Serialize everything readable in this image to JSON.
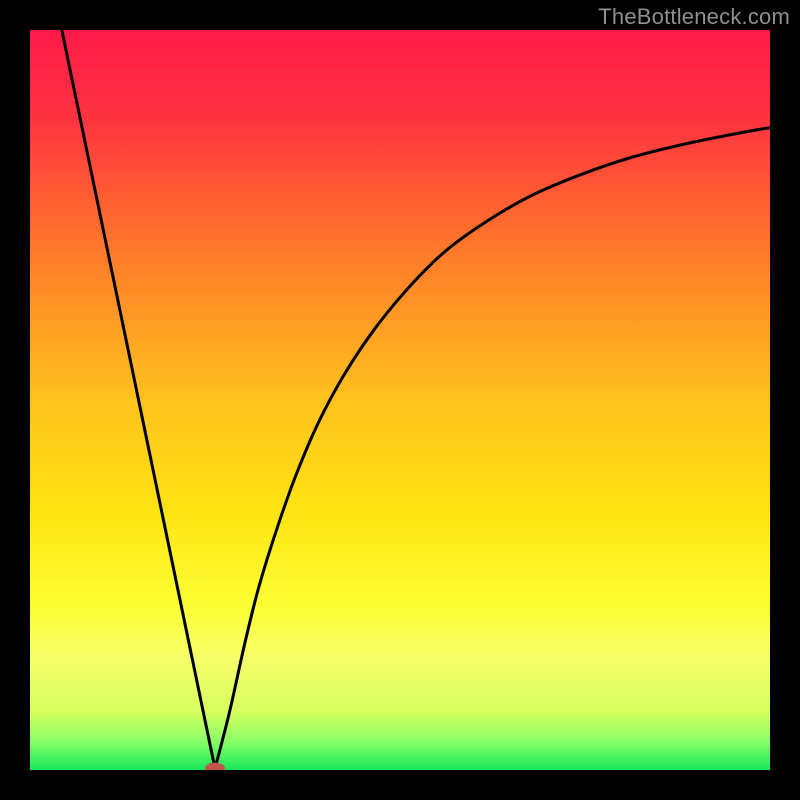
{
  "watermark": "TheBottleneck.com",
  "chart_data": {
    "type": "line",
    "title": "",
    "xlabel": "",
    "ylabel": "",
    "xlim": [
      0,
      100
    ],
    "ylim": [
      0,
      100
    ],
    "gradient_stops": [
      {
        "offset": 0.0,
        "color": "#ff1a4b"
      },
      {
        "offset": 0.12,
        "color": "#ff3340"
      },
      {
        "offset": 0.3,
        "color": "#ff7a2a"
      },
      {
        "offset": 0.5,
        "color": "#ffc21d"
      },
      {
        "offset": 0.65,
        "color": "#ffe312"
      },
      {
        "offset": 0.78,
        "color": "#fbff33"
      },
      {
        "offset": 0.85,
        "color": "#f6ff6b"
      },
      {
        "offset": 0.92,
        "color": "#d8ff5e"
      },
      {
        "offset": 0.96,
        "color": "#8cff66"
      },
      {
        "offset": 1.0,
        "color": "#17e85a"
      }
    ],
    "series": [
      {
        "name": "left-line",
        "x": [
          4.3,
          25.0
        ],
        "y": [
          100.0,
          0.2
        ]
      },
      {
        "name": "right-curve",
        "x": [
          25.0,
          27.0,
          29.0,
          31.0,
          33.5,
          36.0,
          39.0,
          42.5,
          46.5,
          51.0,
          56.0,
          61.5,
          67.5,
          74.0,
          81.0,
          88.5,
          96.5,
          100.0
        ],
        "y": [
          0.2,
          8.0,
          17.0,
          25.0,
          33.0,
          40.0,
          47.0,
          53.5,
          59.5,
          65.0,
          70.0,
          74.0,
          77.5,
          80.3,
          82.7,
          84.6,
          86.2,
          86.8
        ]
      }
    ],
    "marker": {
      "x": 25.0,
      "y": 0.2,
      "color": "#c1534a"
    }
  }
}
